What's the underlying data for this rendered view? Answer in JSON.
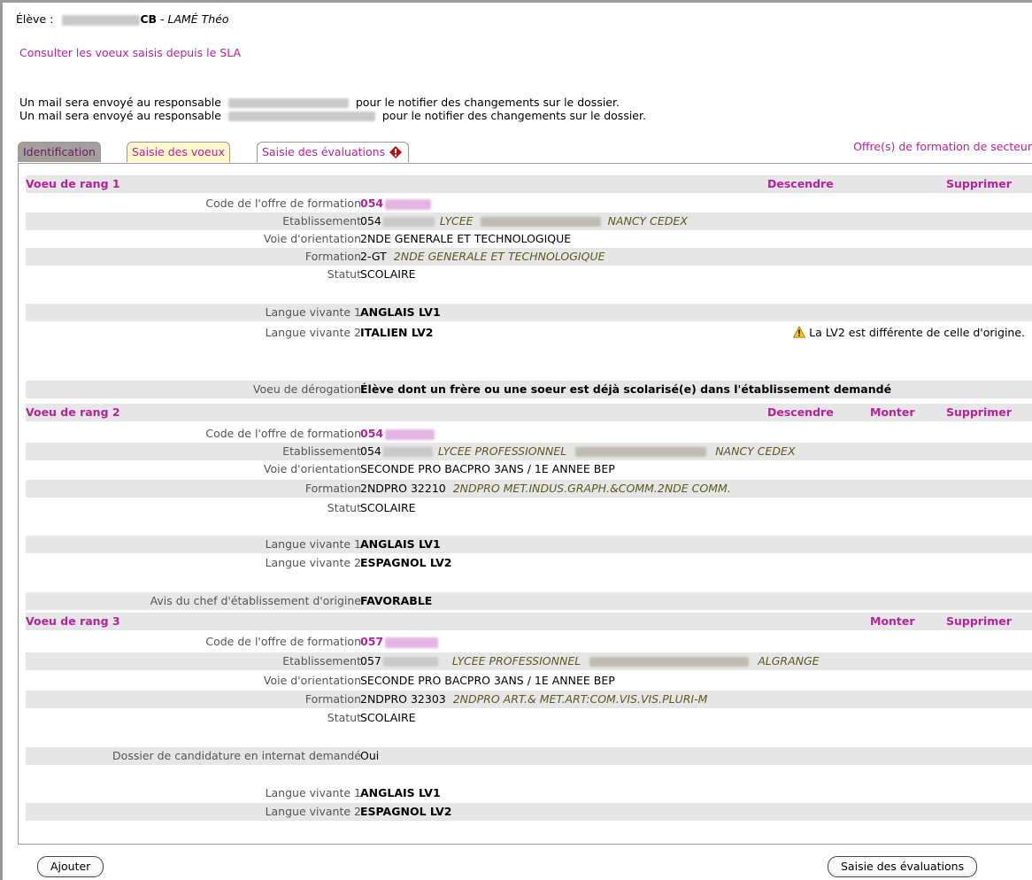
{
  "student": {
    "label": "Élève :",
    "code_suffix": "CB",
    "separator": " - ",
    "name": "LAMÉ Théo"
  },
  "sla_link": "Consulter les voeux saisis depuis le SLA",
  "mail_lines": [
    {
      "prefix": "Un mail sera envoyé au responsable",
      "suffix": "pour le notifier des changements sur le dossier."
    },
    {
      "prefix": "Un mail sera envoyé au responsable",
      "suffix": "pour le notifier des changements sur le dossier."
    }
  ],
  "tabs": [
    "Identification",
    "Saisie des voeux",
    "Saisie des évaluations"
  ],
  "offre_link": "Offre(s) de formation de secteur",
  "actions": {
    "descendre": "Descendre",
    "monter": "Monter",
    "supprimer": "Supprimer"
  },
  "labels": {
    "code": "Code de l'offre de formation",
    "etab": "Etablissement",
    "voie": "Voie d'orientation",
    "formation": "Formation",
    "statut": "Statut",
    "lv1": "Langue vivante 1",
    "lv2": "Langue vivante 2",
    "derogation": "Voeu de dérogation",
    "avis": "Avis du chef d'établissement d'origine",
    "internat": "Dossier de candidature en internat demandé"
  },
  "voeux": [
    {
      "title": "Voeu de rang 1",
      "code_prefix": "054",
      "etab_code": "054",
      "etab_type": "LYCEE",
      "etab_city": "NANCY CEDEX",
      "voie": "2NDE GENERALE ET TECHNOLOGIQUE",
      "formation_code": "2-GT",
      "formation_label": "2NDE GENERALE ET TECHNOLOGIQUE",
      "statut": "SCOLAIRE",
      "lv1": "ANGLAIS LV1",
      "lv2": "ITALIEN LV2",
      "lv2_warning": "La LV2 est différente de celle d'origine.",
      "derogation": "Élève dont un frère ou une soeur est déjà scolarisé(e) dans l'établissement demandé"
    },
    {
      "title": "Voeu de rang 2",
      "code_prefix": "054",
      "etab_code": "054",
      "etab_type": "LYCEE PROFESSIONNEL",
      "etab_city": "NANCY CEDEX",
      "voie": "SECONDE PRO BACPRO 3ANS / 1E ANNEE BEP",
      "formation_code": "2NDPRO 32210",
      "formation_label": "2NDPRO MET.INDUS.GRAPH.&COMM.2NDE COMM.",
      "statut": "SCOLAIRE",
      "lv1": "ANGLAIS LV1",
      "lv2": "ESPAGNOL LV2",
      "avis": "FAVORABLE"
    },
    {
      "title": "Voeu de rang 3",
      "code_prefix": "057",
      "etab_code": "057",
      "etab_type": "LYCEE PROFESSIONNEL",
      "etab_city": "ALGRANGE",
      "voie": "SECONDE PRO BACPRO 3ANS / 1E ANNEE BEP",
      "formation_code": "2NDPRO 32303",
      "formation_label": "2NDPRO ART.& MET.ART:COM.VIS.VIS.PLURI-M",
      "statut": "SCOLAIRE",
      "internat": "Oui",
      "lv1": "ANGLAIS LV1",
      "lv2": "ESPAGNOL LV2"
    }
  ],
  "buttons": {
    "ajouter": "Ajouter",
    "evaluations": "Saisie des évaluations"
  },
  "colors": {
    "accent": "#b5239b",
    "row_alt": "#e6e6e6",
    "tab_active": "#fff8cc"
  }
}
